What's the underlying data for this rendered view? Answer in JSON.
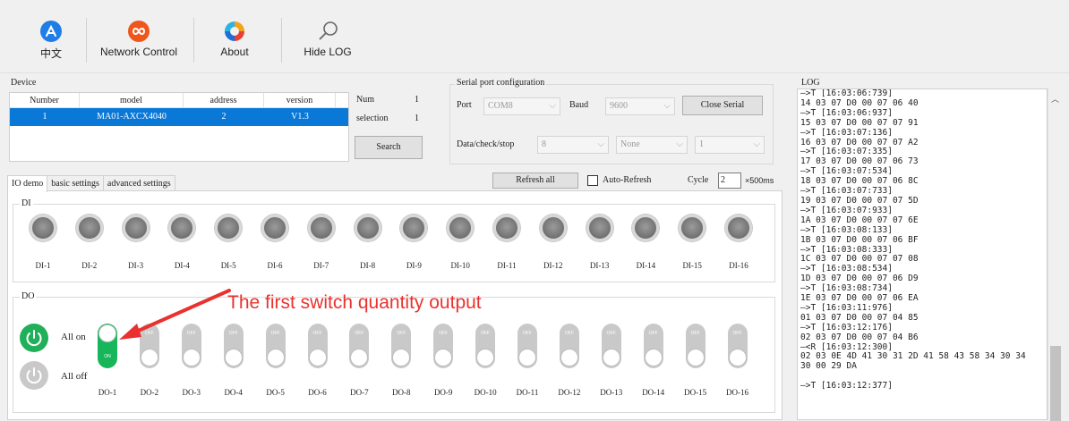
{
  "toolbar": {
    "lang_label": "中文",
    "network_label": "Network Control",
    "about_label": "About",
    "hidelog_label": "Hide LOG"
  },
  "device": {
    "group_label": "Device",
    "columns": [
      "Number",
      "model",
      "address",
      "version"
    ],
    "row": [
      "1",
      "MA01-AXCX4040",
      "2",
      "V1.3"
    ],
    "num_label": "Num",
    "num_value": "1",
    "selection_label": "selection",
    "selection_value": "1",
    "search_label": "Search"
  },
  "serial": {
    "group_label": "Serial port configuration",
    "port_label": "Port",
    "port_value": "COM8",
    "baud_label": "Baud",
    "baud_value": "9600",
    "close_label": "Close Serial",
    "dcs_label": "Data/check/stop",
    "data_value": "8",
    "check_value": "None",
    "stop_value": "1"
  },
  "tabs": [
    "IO demo",
    "basic settings",
    "advanced settings"
  ],
  "controls": {
    "refresh_label": "Refresh all",
    "auto_label": "Auto-Refresh",
    "auto_checked": false,
    "cycle_label": "Cycle",
    "cycle_value": "2",
    "cycle_unit": "×500ms"
  },
  "di": {
    "label": "DI",
    "items": [
      "DI-1",
      "DI-2",
      "DI-3",
      "DI-4",
      "DI-5",
      "DI-6",
      "DI-7",
      "DI-8",
      "DI-9",
      "DI-10",
      "DI-11",
      "DI-12",
      "DI-13",
      "DI-14",
      "DI-15",
      "DI-16"
    ]
  },
  "do": {
    "label": "DO",
    "all_on_label": "All on",
    "all_off_label": "All off",
    "items": [
      "DO-1",
      "DO-2",
      "DO-3",
      "DO-4",
      "DO-5",
      "DO-6",
      "DO-7",
      "DO-8",
      "DO-9",
      "DO-10",
      "DO-11",
      "DO-12",
      "DO-13",
      "DO-14",
      "DO-15",
      "DO-16"
    ],
    "states": [
      true,
      false,
      false,
      false,
      false,
      false,
      false,
      false,
      false,
      false,
      false,
      false,
      false,
      false,
      false,
      false
    ],
    "on_text": "ON",
    "off_text": "OFF"
  },
  "annotation": "The first switch quantity output",
  "colors": {
    "accent_red": "#e9322f",
    "switch_on": "#18b65a",
    "selected_row": "#0a78d7"
  },
  "log": {
    "label": "LOG",
    "lines": [
      "—>T [16:03:06:739]",
      "14 03 07 D0 00 07 06 40",
      "—>T [16:03:06:937]",
      "15 03 07 D0 00 07 07 91",
      "—>T [16:03:07:136]",
      "16 03 07 D0 00 07 07 A2",
      "—>T [16:03:07:335]",
      "17 03 07 D0 00 07 06 73",
      "—>T [16:03:07:534]",
      "18 03 07 D0 00 07 06 8C",
      "—>T [16:03:07:733]",
      "19 03 07 D0 00 07 07 5D",
      "—>T [16:03:07:933]",
      "1A 03 07 D0 00 07 07 6E",
      "—>T [16:03:08:133]",
      "1B 03 07 D0 00 07 06 BF",
      "—>T [16:03:08:333]",
      "1C 03 07 D0 00 07 07 08",
      "—>T [16:03:08:534]",
      "1D 03 07 D0 00 07 06 D9",
      "—>T [16:03:08:734]",
      "1E 03 07 D0 00 07 06 EA",
      "—>T [16:03:11:976]",
      "01 03 07 D0 00 07 04 85",
      "—>T [16:03:12:176]",
      "02 03 07 D0 00 07 04 B6",
      "—<R [16:03:12:300]",
      "02 03 0E 4D 41 30 31 2D 41 58 43 58 34 30 34",
      "30 00 29 DA",
      "",
      "—>T [16:03:12:377]"
    ]
  }
}
